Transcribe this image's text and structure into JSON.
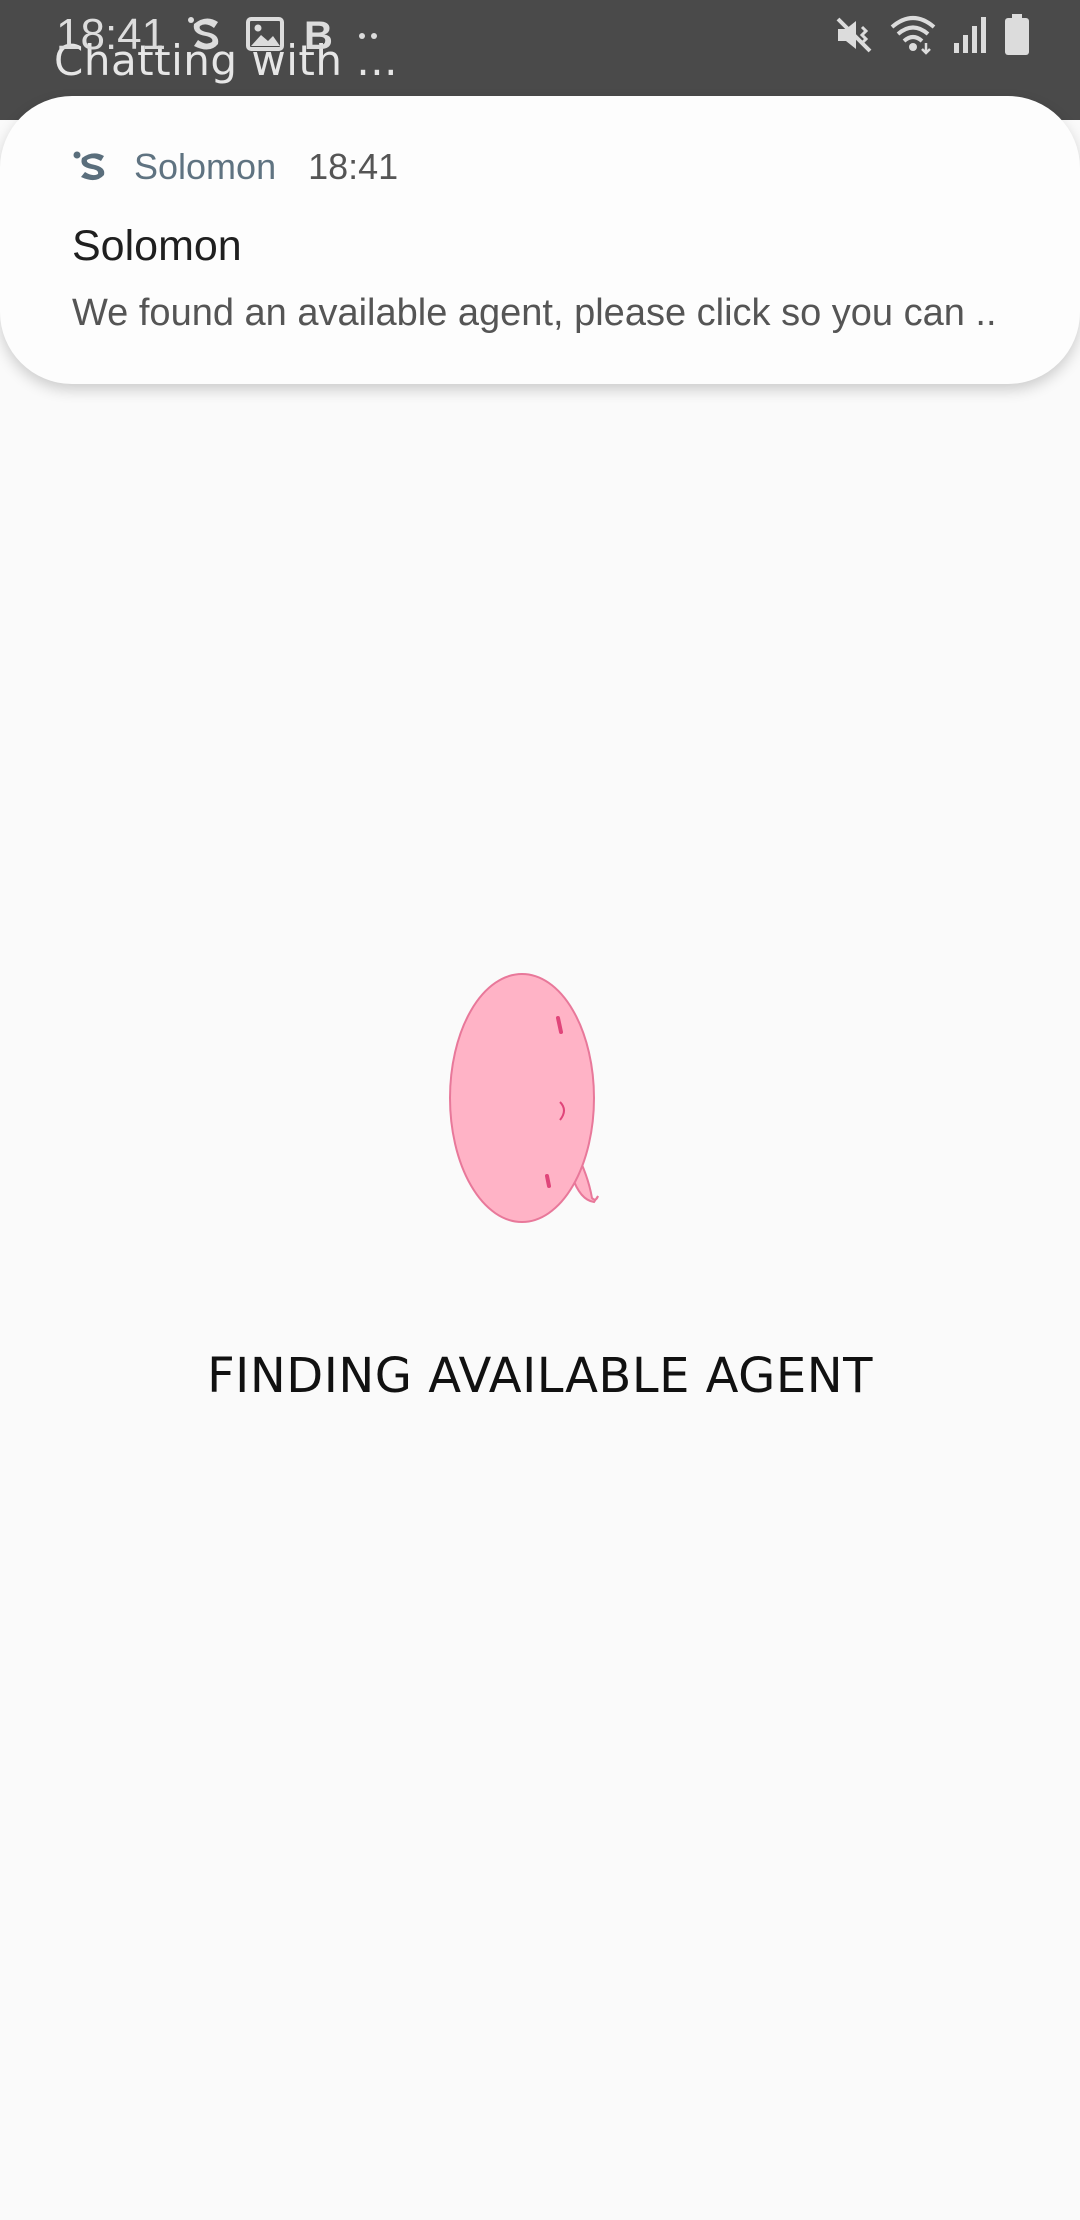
{
  "app_bar": {
    "title": "Chatting with ..."
  },
  "status_bar": {
    "time": "18:41",
    "left_icons": [
      "solomon-icon",
      "image-icon",
      "bold-b-icon",
      "more-dots-icon"
    ],
    "right_icons": [
      "vibrate-mute-icon",
      "wifi-icon",
      "signal-icon",
      "battery-icon"
    ]
  },
  "notification": {
    "app_name": "Solomon",
    "time": "18:41",
    "title": "Solomon",
    "body": "We found an available agent, please click so you can .."
  },
  "main": {
    "mascot": "pink-blob-mascot",
    "status_text": "FINDING AVAILABLE AGENT"
  },
  "colors": {
    "app_bar": "#4a4a4a",
    "background": "#fafafa",
    "notification_bg": "#fdfdfd",
    "app_name": "#5f7381",
    "mascot_fill": "#ffb3c6",
    "mascot_stroke": "#e8789a"
  }
}
